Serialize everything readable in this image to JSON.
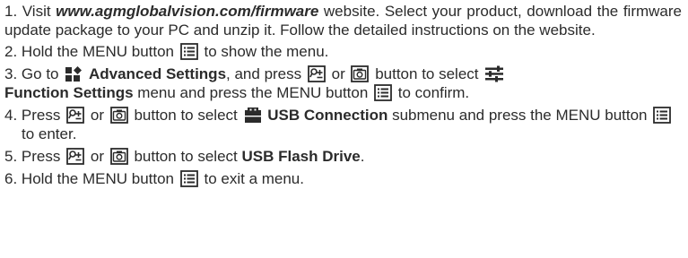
{
  "steps": [
    {
      "num": "1.",
      "t1": "Visit",
      "url": "www.agmglobalvision.com/firmware",
      "t2": "website. Select your product, download the firmware update package to your PC and unzip it. Follow the detailed instructions on the website."
    },
    {
      "num": "2.",
      "t1": "Hold the MENU button",
      "t2": "to show the menu."
    },
    {
      "num": "3.",
      "t1": "Go to",
      "b1": "Advanced Settings",
      "t2": ", and press",
      "t3": "or",
      "t4": "button to select",
      "b2": "Function Settings",
      "t5": "menu and press the MENU button",
      "t6": "to confirm."
    },
    {
      "num": "4.",
      "t1": "Press",
      "t2": "or",
      "t3": "button to select",
      "b1": "USB Connection",
      "t4": "submenu and press the MENU button",
      "t5": "to enter."
    },
    {
      "num": "5.",
      "t1": "Press",
      "t2": "or",
      "t3": "button to select",
      "b1": "USB Flash Drive",
      "t4": "."
    },
    {
      "num": "6.",
      "t1": "Hold the MENU button",
      "t2": "to exit a menu."
    }
  ],
  "icons": {
    "menu": "menu-button-icon",
    "zoom": "zoom-button-icon",
    "camera": "camera-button-icon",
    "advanced": "advanced-settings-icon",
    "function": "function-settings-icon",
    "usb": "usb-connection-icon"
  },
  "colors": {
    "text": "#2b2b2b"
  }
}
